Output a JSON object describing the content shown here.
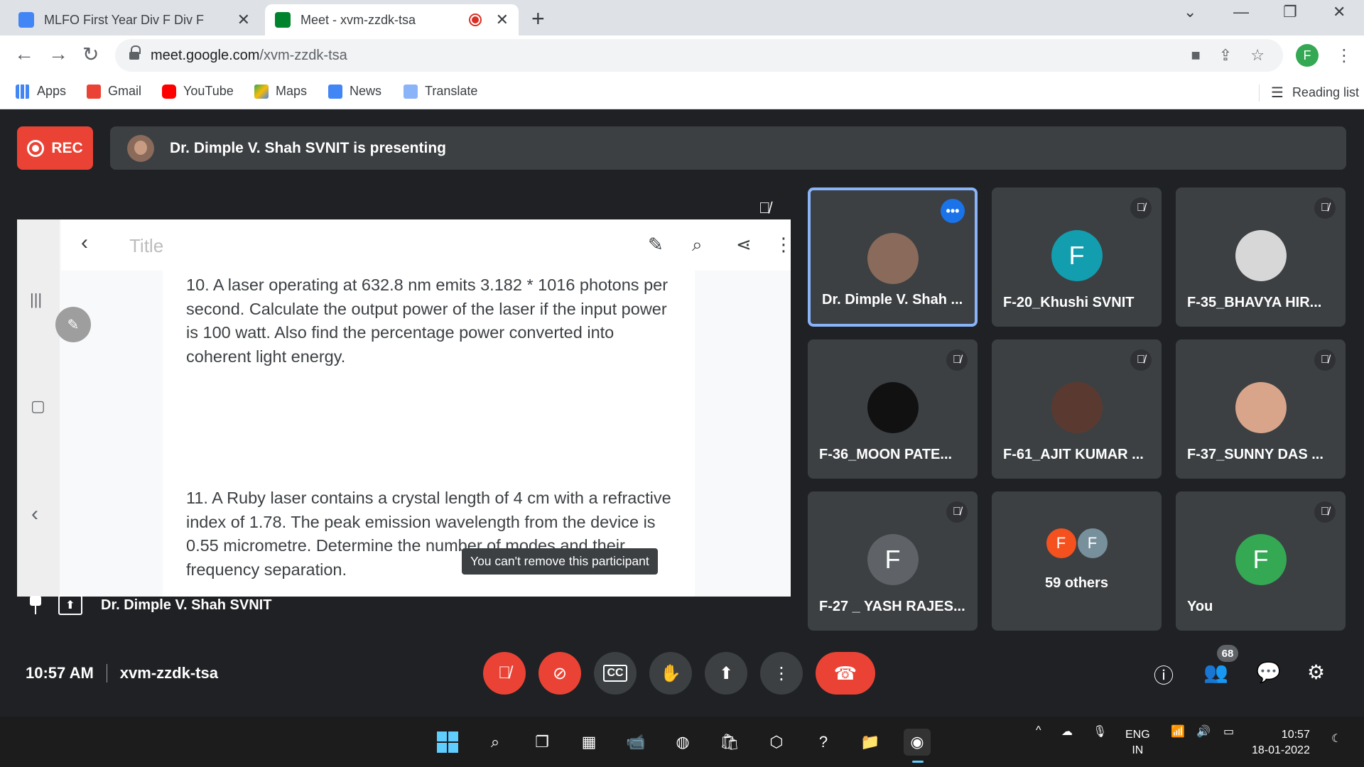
{
  "browser": {
    "tabs": [
      {
        "title": "MLFO First Year Div F Div F",
        "favicon_color": "#4285f4"
      },
      {
        "title": "Meet - xvm-zzdk-tsa",
        "favicon_color": "#00832d"
      }
    ],
    "url_host": "meet.google.com",
    "url_path": "/xvm-zzdk-tsa",
    "profile_initial": "F",
    "bookmarks": [
      {
        "label": "Apps",
        "icon": "apps-grid-icon"
      },
      {
        "label": "Gmail",
        "icon": "gmail-icon"
      },
      {
        "label": "YouTube",
        "icon": "youtube-icon"
      },
      {
        "label": "Maps",
        "icon": "maps-icon"
      },
      {
        "label": "News",
        "icon": "news-icon"
      },
      {
        "label": "Translate",
        "icon": "translate-icon"
      }
    ],
    "reading_list": "Reading list"
  },
  "meet": {
    "rec_label": "REC",
    "presenting_text": "Dr. Dimple V. Shah SVNIT is presenting",
    "presentation": {
      "doc_title_placeholder": "Title",
      "question_10": "10.  A laser operating at 632.8 nm emits 3.182 * 1016 photons per second. Calculate the output power of the laser if the input power is 100 watt. Also find the percentage power converted into coherent light energy.",
      "question_11": "11.  A Ruby laser contains a crystal length of 4 cm with a refractive index of 1.78. The peak emission wavelength from the device is 0.55 micrometre. Determine the number of modes and their frequency separation.",
      "tooltip": "You can't remove this participant",
      "presenter_name": "Dr. Dimple V. Shah SVNIT"
    },
    "participants": [
      {
        "name": "Dr. Dimple V. Shah ...",
        "initial": "",
        "color": "#8a6a5a"
      },
      {
        "name": "F-20_Khushi SVNIT",
        "initial": "F",
        "color": "#129eaf"
      },
      {
        "name": "F-35_BHAVYA HIR...",
        "initial": "",
        "color": "#d7d7d7"
      },
      {
        "name": "F-36_MOON PATE...",
        "initial": "",
        "color": "#111111"
      },
      {
        "name": "F-61_AJIT KUMAR ...",
        "initial": "",
        "color": "#5a3a30"
      },
      {
        "name": "F-37_SUNNY DAS ...",
        "initial": "",
        "color": "#d9a58a"
      },
      {
        "name": "F-27 _ YASH RAJES...",
        "initial": "F",
        "color": "#5f6368"
      }
    ],
    "others": {
      "label": "59 others",
      "initials": [
        "F",
        "F"
      ],
      "colors": [
        "#f4511e",
        "#78909c"
      ]
    },
    "self": {
      "name": "You",
      "initial": "F",
      "color": "#34a853"
    },
    "clock": "10:57 AM",
    "meeting_code": "xvm-zzdk-tsa",
    "people_count": "68"
  },
  "taskbar": {
    "lang_line1": "ENG",
    "lang_line2": "IN",
    "time": "10:57",
    "date": "18-01-2022"
  }
}
